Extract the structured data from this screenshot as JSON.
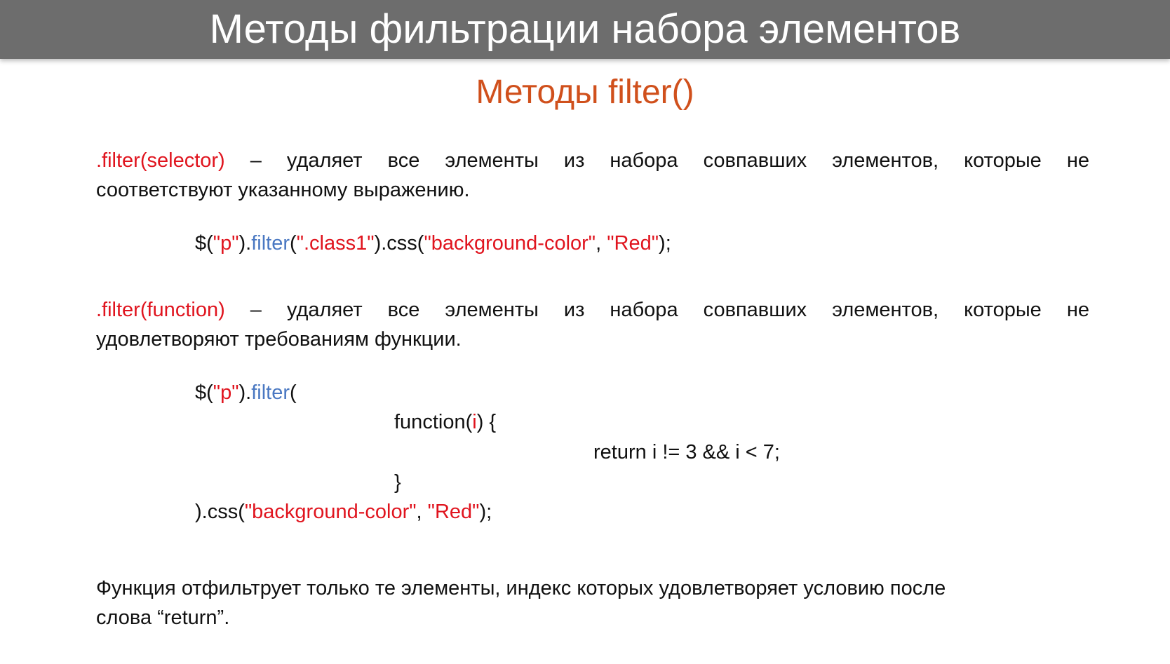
{
  "slide": {
    "title": "Методы фильтрации набора элементов",
    "subtitle": "Методы filter()",
    "colors": {
      "title_bar": "#6d6d6d",
      "subtitle": "#d0501c",
      "keyword_red": "#e0141e",
      "method_blue": "#4a78c2"
    }
  },
  "section1": {
    "term": ".filter(selector)",
    "desc_line1": " – удаляет все элементы из набора совпавших элементов, которые не",
    "desc_line2": "соответствуют указанному выражению."
  },
  "code1": {
    "p1": "$(",
    "s1": "\"p\"",
    "p2": ").",
    "m1": "filter",
    "p3": "(",
    "s2": "\".class1\"",
    "p4": ").css(",
    "s3": "\"background-color\"",
    "p5": ", ",
    "s4": "\"Red\"",
    "p6": ");"
  },
  "section2": {
    "term": ".filter(function)",
    "desc_line1": " – удаляет все элементы из набора совпавших элементов, которые не",
    "desc_line2": "удовлетворяют требованиям функции."
  },
  "code2": {
    "l1_p1": "$(",
    "l1_s1": "\"p\"",
    "l1_p2": ").",
    "l1_m1": "filter",
    "l1_p3": "(",
    "l2_p1": "function(",
    "l2_arg": "i",
    "l2_p2": ") {",
    "l3": "return i != 3 && i < 7;",
    "l4": "}",
    "l5_p1": ").css(",
    "l5_s1": "\"background-color\"",
    "l5_p2": ", ",
    "l5_s2": "\"Red\"",
    "l5_p3": ");"
  },
  "footer": {
    "line1": "Функция отфильтрует только те элементы, индекс которых удовлетворяет условию после",
    "line2": "слова “return”."
  }
}
